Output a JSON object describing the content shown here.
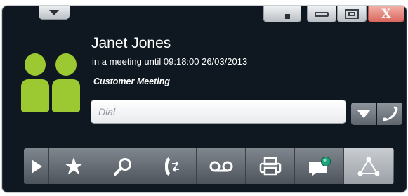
{
  "window": {
    "controls": {
      "close_label": "X"
    }
  },
  "contact": {
    "name": "Janet Jones",
    "status": "in a meeting until 09:18:00 26/03/2013",
    "subject": "Customer Meeting",
    "avatar_color": "#9cc832"
  },
  "dial": {
    "placeholder": "Dial",
    "value": ""
  },
  "toolbar": {
    "items": [
      {
        "icon": "play-icon",
        "active": false
      },
      {
        "icon": "star-icon",
        "active": false
      },
      {
        "icon": "search-icon",
        "active": false
      },
      {
        "icon": "phone-transfer-icon",
        "active": false
      },
      {
        "icon": "voicemail-icon",
        "active": false
      },
      {
        "icon": "fax-icon",
        "active": false
      },
      {
        "icon": "chat-presence-icon",
        "active": false
      },
      {
        "icon": "network-icon",
        "active": true
      }
    ]
  },
  "colors": {
    "window_bg": "#0f1720",
    "accent_green": "#9cc832",
    "close_red": "#d9645a",
    "chat_status": "#1fa37a"
  }
}
